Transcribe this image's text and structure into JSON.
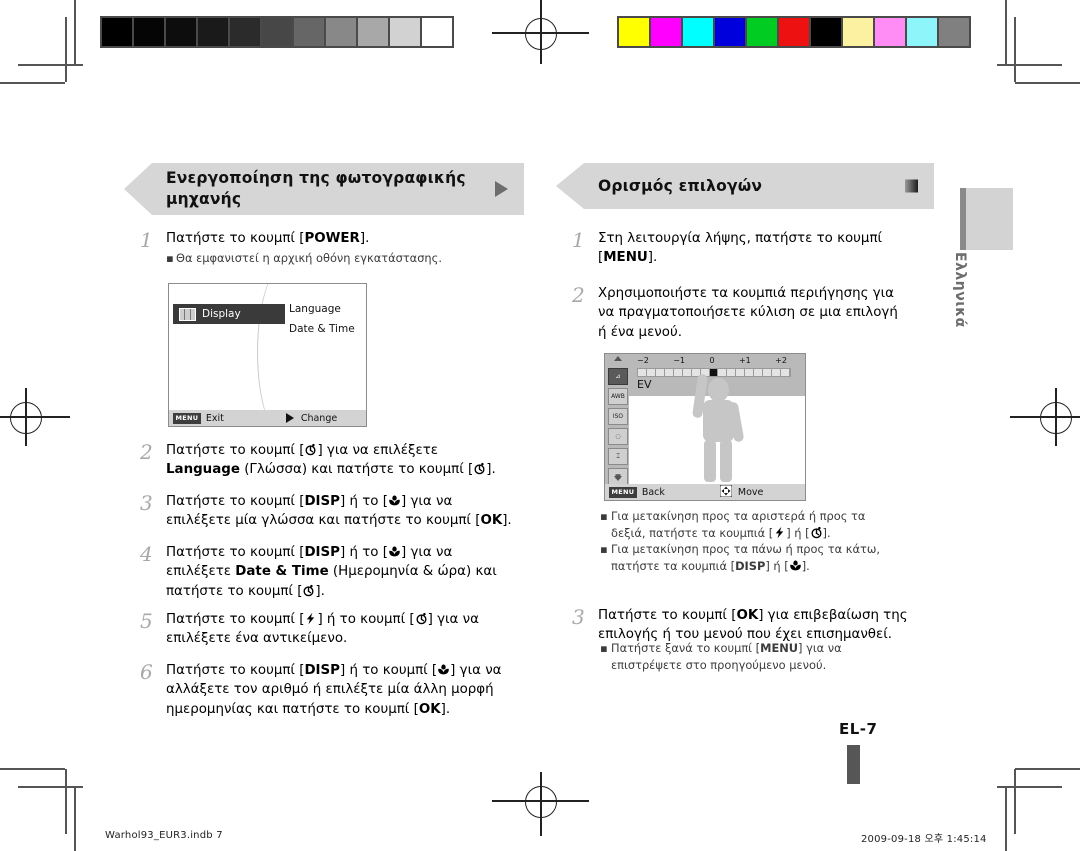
{
  "document": {
    "page_label": "EL-7",
    "language_tab": "Ελληνικά",
    "footer_left": "Warhol93_EUR3.indb   7",
    "footer_right": "2009-09-18   오후 1:45:14"
  },
  "calibration": {
    "gray_swatches": [
      "#000000",
      "#050505",
      "#0d0d0d",
      "#1a1a1a",
      "#2b2b2b",
      "#474747",
      "#666666",
      "#888888",
      "#a8a8a8",
      "#d2d2d2",
      "#ffffff"
    ],
    "color_swatches": [
      "#ffff00",
      "#ff00ff",
      "#00ffff",
      "#0000dd",
      "#00cc22",
      "#ee1111",
      "#000000",
      "#fbf1a0",
      "#ff8df5",
      "#8ef6fb",
      "#808080"
    ]
  },
  "left_column": {
    "header": {
      "title": "Ενεργοποίηση της φωτογραφικής μηχανής",
      "marker": "triangle-mark"
    },
    "steps": [
      {
        "num": "1",
        "lines": [
          {
            "parts": [
              {
                "t": "Πατήστε το κουμπί ["
              },
              {
                "t": "POWER",
                "bold": true
              },
              {
                "t": "]."
              }
            ]
          }
        ],
        "bullets": [
          "Θα εμφανιστεί η αρχική οθόνη εγκατάστασης."
        ]
      },
      {
        "num": "2",
        "lines": [
          {
            "parts": [
              {
                "t": "Πατήστε το κουμπί ["
              },
              {
                "icon": "timer-icon"
              },
              {
                "t": "] για να επιλέξετε"
              }
            ]
          },
          {
            "parts": [
              {
                "t": "Language",
                "bold": true
              },
              {
                "t": " (Γλώσσα) και πατήστε το κουμπί ["
              },
              {
                "icon": "timer-icon"
              },
              {
                "t": "]."
              }
            ]
          }
        ],
        "bullets": []
      },
      {
        "num": "3",
        "lines": [
          {
            "parts": [
              {
                "t": "Πατήστε το κουμπί ["
              },
              {
                "t": "DISP",
                "bold": true
              },
              {
                "t": "] ή το ["
              },
              {
                "icon": "macro-icon"
              },
              {
                "t": "] για να"
              }
            ]
          },
          {
            "parts": [
              {
                "t": "επιλέξετε μία γλώσσα και πατήστε το κουμπί ["
              },
              {
                "t": "OK",
                "bold": true
              },
              {
                "t": "]."
              }
            ]
          }
        ],
        "bullets": []
      },
      {
        "num": "4",
        "lines": [
          {
            "parts": [
              {
                "t": "Πατήστε το κουμπί ["
              },
              {
                "t": "DISP",
                "bold": true
              },
              {
                "t": "] ή το ["
              },
              {
                "icon": "macro-icon"
              },
              {
                "t": "] για να"
              }
            ]
          },
          {
            "parts": [
              {
                "t": "επιλέξετε "
              },
              {
                "t": "Date & Time",
                "bold": true
              },
              {
                "t": " (Ημερομηνία & ώρα) και"
              }
            ]
          },
          {
            "parts": [
              {
                "t": "πατήστε το κουμπί ["
              },
              {
                "icon": "timer-icon"
              },
              {
                "t": "]."
              }
            ]
          }
        ],
        "bullets": []
      },
      {
        "num": "5",
        "lines": [
          {
            "parts": [
              {
                "t": "Πατήστε το κουμπί ["
              },
              {
                "icon": "flash-icon"
              },
              {
                "t": "] ή το κουμπί ["
              },
              {
                "icon": "timer-icon"
              },
              {
                "t": "] για να"
              }
            ]
          },
          {
            "parts": [
              {
                "t": "επιλέξετε ένα αντικείμενο."
              }
            ]
          }
        ],
        "bullets": []
      },
      {
        "num": "6",
        "lines": [
          {
            "parts": [
              {
                "t": "Πατήστε το κουμπί ["
              },
              {
                "t": "DISP",
                "bold": true
              },
              {
                "t": "] ή το κουμπί ["
              },
              {
                "icon": "macro-icon"
              },
              {
                "t": "] για να"
              }
            ]
          },
          {
            "parts": [
              {
                "t": "αλλάξετε τον αριθμό ή επιλέξτε μία άλλη μορφή"
              }
            ]
          },
          {
            "parts": [
              {
                "t": "ημερομηνίας και πατήστε το κουμπί ["
              },
              {
                "t": "OK",
                "bold": true
              },
              {
                "t": "]."
              }
            ]
          }
        ],
        "bullets": []
      }
    ],
    "lcd_screen": {
      "selected_item": "Display",
      "menu_items": [
        "Language",
        "Date & Time"
      ],
      "bottom_left_chip": "MENU",
      "bottom_left_label": "Exit",
      "bottom_right_icon": "play-arrow-icon",
      "bottom_right_label": "Change"
    }
  },
  "right_column": {
    "header": {
      "title": "Ορισμός επιλογών",
      "marker": "square-mark"
    },
    "steps": [
      {
        "num": "1",
        "lines": [
          {
            "parts": [
              {
                "t": "Στη λειτουργία λήψης, πατήστε το κουμπί"
              }
            ]
          },
          {
            "parts": [
              {
                "t": "["
              },
              {
                "t": "MENU",
                "bold": true
              },
              {
                "t": "]."
              }
            ]
          }
        ],
        "bullets": []
      },
      {
        "num": "2",
        "lines": [
          {
            "parts": [
              {
                "t": "Χρησιμοποιήστε τα κουμπιά περιήγησης για"
              }
            ]
          },
          {
            "parts": [
              {
                "t": "να πραγματοποιήσετε κύλιση σε μια επιλογή"
              }
            ]
          },
          {
            "parts": [
              {
                "t": "ή ένα μενού."
              }
            ]
          }
        ],
        "bullets": []
      },
      {
        "num": "3",
        "lines": [
          {
            "parts": [
              {
                "t": "Πατήστε το κουμπί ["
              },
              {
                "t": "OK",
                "bold": true
              },
              {
                "t": "] για επιβεβαίωση της"
              }
            ]
          },
          {
            "parts": [
              {
                "t": "επιλογής ή του μενού που έχει επισημανθεί."
              }
            ]
          }
        ],
        "bullets": []
      }
    ],
    "mid_bullets": [
      [
        {
          "t": "Για μετακίνηση προς τα αριστερά ή προς τα"
        }
      ],
      [
        {
          "t": "δεξιά, πατήστε τα κουμπιά ["
        },
        {
          "icon": "flash-icon"
        },
        {
          "t": "] ή ["
        },
        {
          "icon": "timer-icon"
        },
        {
          "t": "]."
        }
      ],
      [
        {
          "t": "Για μετακίνηση προς τα πάνω ή προς τα κάτω,"
        }
      ],
      [
        {
          "t": "πατήστε τα κουμπιά ["
        },
        {
          "t": "DISP",
          "bold": true
        },
        {
          "t": "] ή ["
        },
        {
          "icon": "macro-icon"
        },
        {
          "t": "]."
        }
      ]
    ],
    "end_bullets": [
      [
        {
          "t": "Πατήστε ξανά το κουμπί ["
        },
        {
          "t": "MENU",
          "bold": true
        },
        {
          "t": "] για να"
        }
      ],
      [
        {
          "t": "επιστρέψετε στο προηγούμενο μενού."
        }
      ]
    ],
    "lcd_screen": {
      "scale_labels": [
        "−2",
        "−1",
        "0",
        "+1",
        "+2"
      ],
      "value_label": "EV",
      "side_icons": [
        "ev-compensation-icon",
        "white-balance-icon",
        "iso-icon",
        "face-detection-off-icon",
        "focus-area-icon",
        "metering-icon",
        "drive-off-icon"
      ],
      "bottom_left_chip": "MENU",
      "bottom_left_label": "Back",
      "bottom_right_icon": "four-way-icon",
      "bottom_right_label": "Move"
    }
  }
}
